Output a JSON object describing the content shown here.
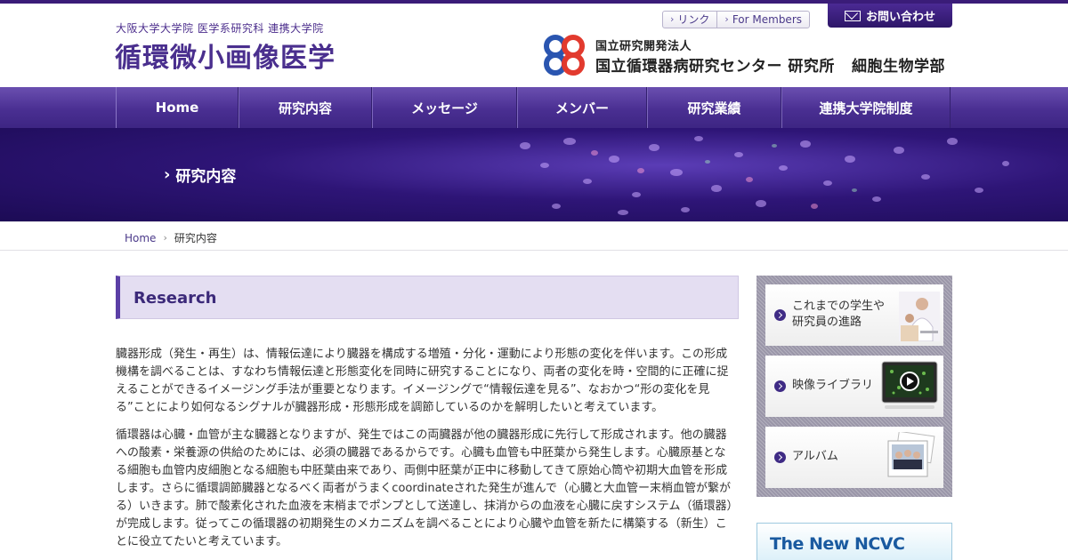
{
  "header": {
    "site_subtitle": "大阪大学大学院 医学系研究科 連携大学院",
    "site_title": "循環微小画像医学",
    "util_links": [
      "リンク",
      "For Members"
    ],
    "contact_label": "お問い合わせ",
    "ncvc_sub": "国立研究開発法人",
    "ncvc_name": "国立循環器病研究センター 研究所",
    "ncvc_dept": "細胞生物学部"
  },
  "nav": {
    "items": [
      "Home",
      "研究内容",
      "メッセージ",
      "メンバー",
      "研究業績",
      "連携大学院制度"
    ]
  },
  "hero": {
    "title": "研究内容"
  },
  "breadcrumb": {
    "home": "Home",
    "current": "研究内容"
  },
  "main": {
    "section_title": "Research",
    "paragraphs": [
      "臓器形成（発生・再生）は、情報伝達により臓器を構成する増殖・分化・運動により形態の変化を伴います。この形成機構を調べることは、すなわち情報伝達と形態変化を同時に研究することになり、両者の変化を時・空間的に正確に捉えることができるイメージング手法が重要となります。イメージングで“情報伝達を見る”、なおかつ“形の変化を見る”ことにより如何なるシグナルが臓器形成・形態形成を調節しているのかを解明したいと考えています。",
      "循環器は心臓・血管が主な臓器となりますが、発生ではこの両臓器が他の臓器形成に先行して形成されます。他の臓器への酸素・栄養源の供給のためには、必須の臓器であるからです。心臓も血管も中胚葉から発生します。心臓原基となる細胞も血管内皮細胞となる細胞も中胚葉由来であり、両側中胚葉が正中に移動してきて原始心筒や初期大血管を形成します。さらに循環調節臓器となるべく両者がうまくcoordinateされた発生が進んで（心臓と大血管ー末梢血管が繋がる）いきます。肺で酸素化された血液を末梢までポンプとして送達し、抹消からの血液を心臓に戻すシステム（循環器）が完成します。従ってこの循環器の初期発生のメカニズムを調べることにより心臓や血管を新たに構築する（新生）ことに役立てたいと考えています。"
    ]
  },
  "sidebar": {
    "cards": [
      {
        "label_line1": "これまでの学生や",
        "label_line2": "研究員の進路"
      },
      {
        "label_line1": "映像ライブラリ",
        "label_line2": ""
      },
      {
        "label_line1": "アルバム",
        "label_line2": ""
      }
    ],
    "banner_label": "The New NCVC"
  },
  "colors": {
    "brand_purple": "#4a2f8e",
    "nav_purple": "#4a2f92",
    "hero_dark": "#1c0b55"
  }
}
